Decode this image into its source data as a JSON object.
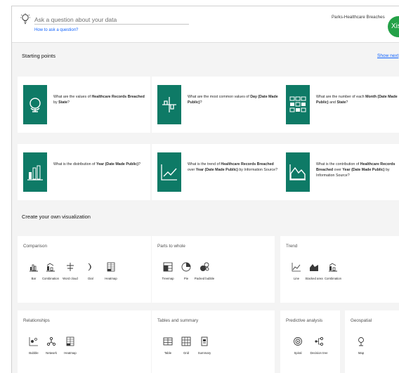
{
  "header": {
    "ask_placeholder": "Ask a question about your data",
    "how_link": "How to ask a question?",
    "data_source": "Parks-Healthcare Breaches",
    "avatar_initials": "Xisv"
  },
  "starting_points": {
    "title": "Starting points",
    "show_next": "Show next",
    "cards": [
      {
        "pre": "What are the values of ",
        "b1": "Healthcare Records Breached",
        "mid": " by ",
        "b2": "State",
        "post": "?",
        "icon": "globe-icon"
      },
      {
        "pre": "What are the most common values of ",
        "b1": "Day (Date Made Public)",
        "mid": "",
        "b2": "",
        "post": "?",
        "icon": "plus-chart-icon"
      },
      {
        "pre": "What are the number of each ",
        "b1": "Month (Date Made Public)",
        "mid": " and ",
        "b2": "State",
        "post": "?",
        "icon": "grid-icon"
      },
      {
        "pre": "What is the distribution of ",
        "b1": "Year (Date Made Public)",
        "mid": "",
        "b2": "",
        "post": "?",
        "icon": "histogram-icon"
      },
      {
        "pre": "What is the trend of ",
        "b1": "Healthcare Records Breached",
        "mid": " over ",
        "b2": "Year (Date Made Public)",
        "post": " by Information Source?",
        "icon": "line-chart-icon"
      },
      {
        "pre": "What is the contribution of ",
        "b1": "Healthcare Records Breached",
        "mid": " over ",
        "b2": "Year (Date Made Public)",
        "post": " by Information Source?",
        "icon": "area-chart-icon"
      }
    ]
  },
  "create": {
    "title": "Create your own visualization",
    "groups": [
      {
        "title": "Comparison",
        "items": [
          "Bar",
          "Combination",
          "Word cloud",
          "Dial",
          "Heatmap"
        ]
      },
      {
        "title": "Parts to whole",
        "items": [
          "Treemap",
          "Pie",
          "Packed bubble"
        ]
      },
      {
        "title": "Trend",
        "items": [
          "Line",
          "Stacked area",
          "Combination"
        ]
      },
      {
        "title": "Relationships",
        "items": [
          "Bubble",
          "Network",
          "Heatmap"
        ]
      },
      {
        "title": "Tables and summary",
        "items": [
          "Table",
          "Grid",
          "Summary"
        ]
      },
      {
        "title": "Predictive analysis",
        "items": [
          "Spiral",
          "Decision tree"
        ]
      },
      {
        "title": "Geospatial",
        "items": [
          "Map"
        ]
      }
    ]
  },
  "colors": {
    "accent_tile": "#0e7a66",
    "link": "#0f62fe",
    "avatar": "#24a148"
  }
}
